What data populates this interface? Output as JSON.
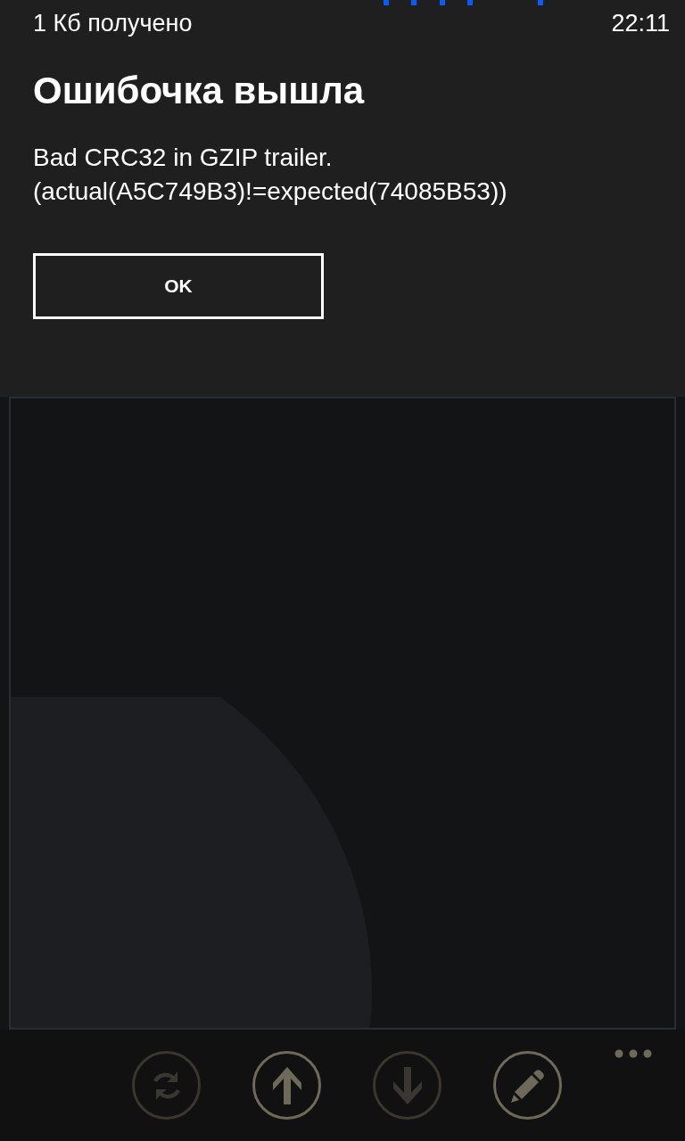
{
  "status_bar": {
    "text": "1 Кб получено",
    "time": "22:11"
  },
  "dialog": {
    "title": "Ошибочка вышла",
    "message": "Bad CRC32 in GZIP trailer. (actual(A5C749B3)!=expected(74085B53))",
    "button": "OK"
  },
  "app_bar": {
    "buttons": [
      {
        "kind": "refresh",
        "disabled": true
      },
      {
        "kind": "upload",
        "disabled": false
      },
      {
        "kind": "download",
        "disabled": true
      },
      {
        "kind": "edit",
        "disabled": false
      }
    ]
  }
}
